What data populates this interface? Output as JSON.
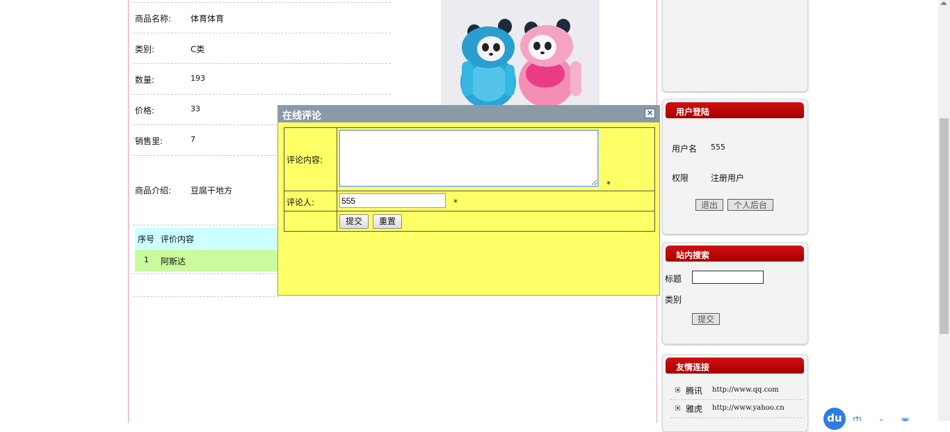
{
  "product": {
    "name_label": "商品名称:",
    "name_value": "体育体育",
    "category_label": "类别:",
    "category_value": "C类",
    "quantity_label": "数量:",
    "quantity_value": "193",
    "price_label": "价格:",
    "price_value": "33",
    "sales_label": "销售里:",
    "sales_value": "7",
    "intro_label": "商品介绍:",
    "intro_value": "豆腐干地方"
  },
  "reviews": {
    "headers": [
      "序号",
      "评价内容"
    ],
    "rows": [
      {
        "index": "1",
        "content": "阿斯达"
      }
    ]
  },
  "dialog": {
    "title": "在线评论",
    "close_glyph": "✕",
    "content_label": "评论内容:",
    "content_value": "",
    "required_mark": "*",
    "reviewer_label": "评论人:",
    "reviewer_value": "555",
    "submit_label": "提交",
    "reset_label": "重置"
  },
  "login_box": {
    "title": "用户登陆",
    "username_label": "用户名",
    "username_value": "555",
    "role_label": "权限",
    "role_value": "注册用户",
    "logout_label": "退出",
    "backend_label": "个人后台"
  },
  "search_box": {
    "title": "站内搜索",
    "title_label": "标题",
    "title_value": "",
    "category_label": "类别",
    "submit_label": "提交"
  },
  "links_box": {
    "title": "友情连接",
    "items": [
      {
        "name": "腾讯",
        "url": "http://www.qq.com"
      },
      {
        "name": "雅虎",
        "url": "http://www.yahoo.cn"
      }
    ]
  },
  "colors": {
    "dialog_bg": "#ffff66",
    "dialog_titlebar": "#8a9aa8",
    "side_title": "#b30000",
    "review_header_bg": "#ccffff",
    "review_row_bg": "#c9fa9c"
  }
}
